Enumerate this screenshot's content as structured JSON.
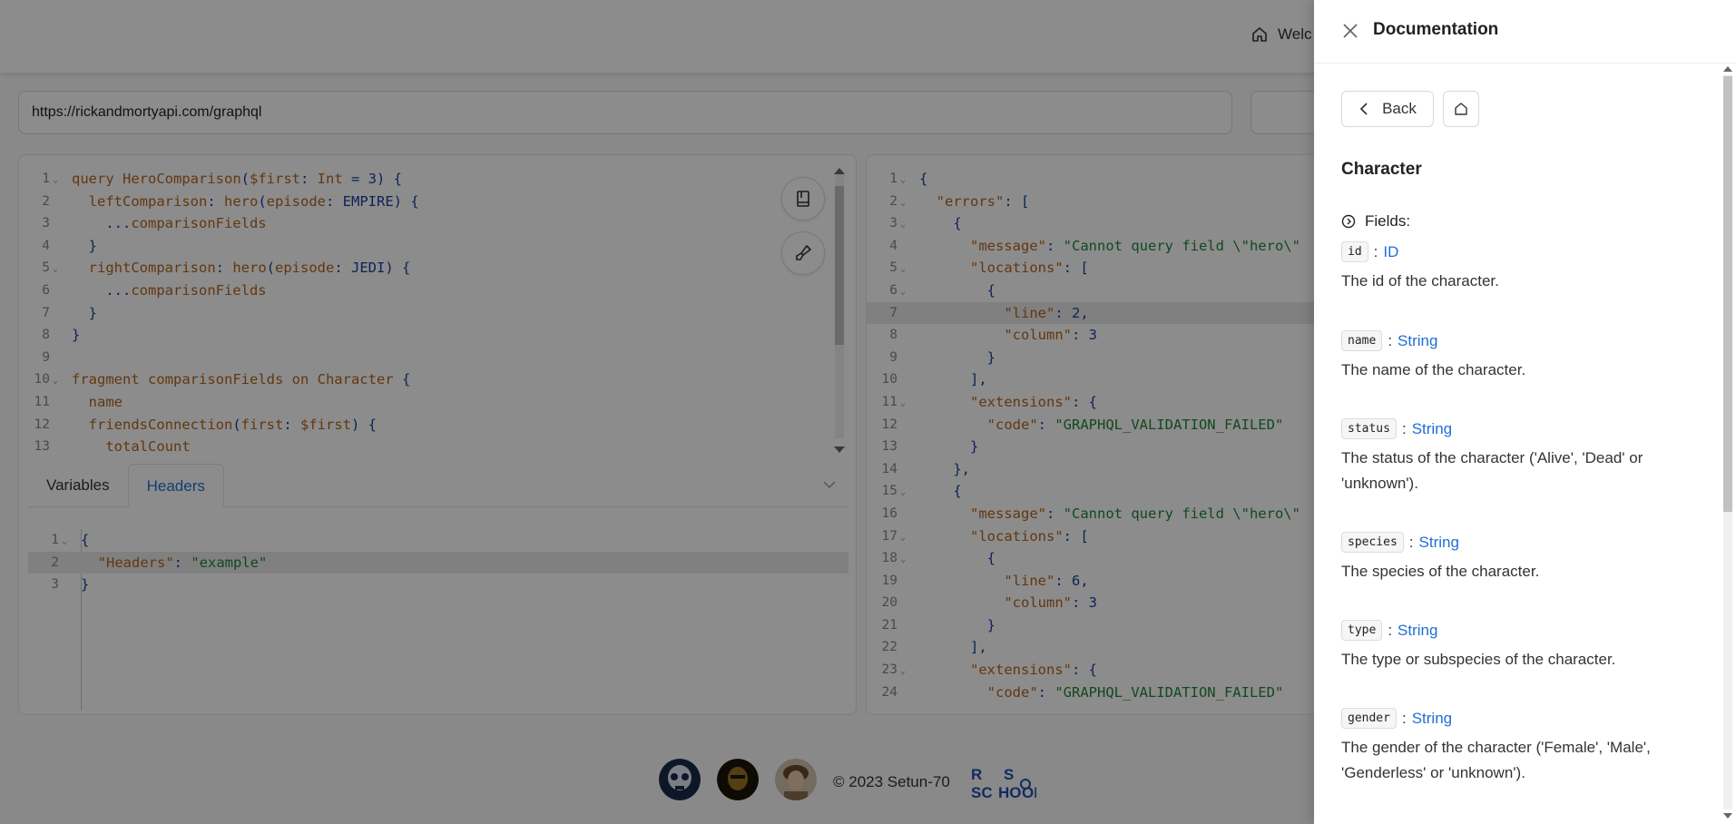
{
  "header": {
    "welcome_label": "Welc"
  },
  "url_bar": {
    "value": "https://rickandmortyapi.com/graphql"
  },
  "query_editor": {
    "lines": [
      {
        "n": "1",
        "fold": true,
        "segs": [
          [
            "kw",
            "query "
          ],
          [
            "fn",
            "HeroComparison"
          ],
          [
            "p",
            "("
          ],
          [
            "var",
            "$first"
          ],
          [
            "p",
            ": "
          ],
          [
            "type",
            "Int"
          ],
          [
            "p",
            " = "
          ],
          [
            "num",
            "3"
          ],
          [
            "p",
            ") {"
          ]
        ]
      },
      {
        "n": "2",
        "fold": false,
        "segs": [
          [
            "p",
            "  "
          ],
          [
            "fn",
            "leftComparison"
          ],
          [
            "p",
            ": "
          ],
          [
            "fn",
            "hero"
          ],
          [
            "p",
            "("
          ],
          [
            "arg",
            "episode"
          ],
          [
            "p",
            ": "
          ],
          [
            "enum",
            "EMPIRE"
          ],
          [
            "p",
            ") {"
          ]
        ]
      },
      {
        "n": "3",
        "fold": false,
        "segs": [
          [
            "p",
            "    ..."
          ],
          [
            "fn",
            "comparisonFields"
          ]
        ]
      },
      {
        "n": "4",
        "fold": false,
        "segs": [
          [
            "p",
            "  }"
          ]
        ]
      },
      {
        "n": "5",
        "fold": true,
        "segs": [
          [
            "p",
            "  "
          ],
          [
            "fn",
            "rightComparison"
          ],
          [
            "p",
            ": "
          ],
          [
            "fn",
            "hero"
          ],
          [
            "p",
            "("
          ],
          [
            "arg",
            "episode"
          ],
          [
            "p",
            ": "
          ],
          [
            "enum",
            "JEDI"
          ],
          [
            "p",
            ") {"
          ]
        ]
      },
      {
        "n": "6",
        "fold": false,
        "segs": [
          [
            "p",
            "    ..."
          ],
          [
            "fn",
            "comparisonFields"
          ]
        ]
      },
      {
        "n": "7",
        "fold": false,
        "segs": [
          [
            "p",
            "  }"
          ]
        ]
      },
      {
        "n": "8",
        "fold": false,
        "segs": [
          [
            "p",
            "}"
          ]
        ]
      },
      {
        "n": "9",
        "fold": false,
        "segs": []
      },
      {
        "n": "10",
        "fold": true,
        "segs": [
          [
            "kw",
            "fragment "
          ],
          [
            "fn",
            "comparisonFields"
          ],
          [
            "kw",
            " on "
          ],
          [
            "fn",
            "Character"
          ],
          [
            "p",
            " {"
          ]
        ]
      },
      {
        "n": "11",
        "fold": false,
        "segs": [
          [
            "p",
            "  "
          ],
          [
            "fn",
            "name"
          ]
        ]
      },
      {
        "n": "12",
        "fold": false,
        "segs": [
          [
            "p",
            "  "
          ],
          [
            "fn",
            "friendsConnection"
          ],
          [
            "p",
            "("
          ],
          [
            "arg",
            "first"
          ],
          [
            "p",
            ": "
          ],
          [
            "var",
            "$first"
          ],
          [
            "p",
            ") {"
          ]
        ]
      },
      {
        "n": "13",
        "fold": false,
        "segs": [
          [
            "p",
            "    "
          ],
          [
            "fn",
            "totalCount"
          ]
        ]
      }
    ]
  },
  "tabs": {
    "variables": "Variables",
    "headers": "Headers"
  },
  "headers_editor": {
    "lines": [
      {
        "n": "1",
        "fold": true,
        "hl": false,
        "segs": [
          [
            "p",
            "{"
          ]
        ]
      },
      {
        "n": "2",
        "fold": false,
        "hl": true,
        "segs": [
          [
            "p",
            "  "
          ],
          [
            "key",
            "\"Headers\""
          ],
          [
            "p",
            ": "
          ],
          [
            "str",
            "\"example\""
          ]
        ]
      },
      {
        "n": "3",
        "fold": false,
        "hl": false,
        "segs": [
          [
            "p",
            "}"
          ]
        ]
      }
    ]
  },
  "result_viewer": {
    "lines": [
      {
        "n": "1",
        "fold": true,
        "hl": false,
        "segs": [
          [
            "p",
            "{"
          ]
        ]
      },
      {
        "n": "2",
        "fold": true,
        "hl": false,
        "segs": [
          [
            "p",
            "  "
          ],
          [
            "key",
            "\"errors\""
          ],
          [
            "p",
            ": ["
          ]
        ]
      },
      {
        "n": "3",
        "fold": true,
        "hl": false,
        "segs": [
          [
            "p",
            "    {"
          ]
        ]
      },
      {
        "n": "4",
        "fold": false,
        "hl": false,
        "segs": [
          [
            "p",
            "      "
          ],
          [
            "key",
            "\"message\""
          ],
          [
            "p",
            ": "
          ],
          [
            "str",
            "\"Cannot query field \\\"hero\\\""
          ]
        ]
      },
      {
        "n": "5",
        "fold": true,
        "hl": false,
        "segs": [
          [
            "p",
            "      "
          ],
          [
            "key",
            "\"locations\""
          ],
          [
            "p",
            ": ["
          ]
        ]
      },
      {
        "n": "6",
        "fold": true,
        "hl": false,
        "segs": [
          [
            "p",
            "        {"
          ]
        ]
      },
      {
        "n": "7",
        "fold": false,
        "hl": true,
        "segs": [
          [
            "p",
            "          "
          ],
          [
            "key",
            "\"line\""
          ],
          [
            "p",
            ": "
          ],
          [
            "num",
            "2"
          ],
          [
            "p",
            ","
          ]
        ]
      },
      {
        "n": "8",
        "fold": false,
        "hl": false,
        "segs": [
          [
            "p",
            "          "
          ],
          [
            "key",
            "\"column\""
          ],
          [
            "p",
            ": "
          ],
          [
            "num",
            "3"
          ]
        ]
      },
      {
        "n": "9",
        "fold": false,
        "hl": false,
        "segs": [
          [
            "p",
            "        }"
          ]
        ]
      },
      {
        "n": "10",
        "fold": false,
        "hl": false,
        "segs": [
          [
            "p",
            "      ],"
          ]
        ]
      },
      {
        "n": "11",
        "fold": true,
        "hl": false,
        "segs": [
          [
            "p",
            "      "
          ],
          [
            "key",
            "\"extensions\""
          ],
          [
            "p",
            ": {"
          ]
        ]
      },
      {
        "n": "12",
        "fold": false,
        "hl": false,
        "segs": [
          [
            "p",
            "        "
          ],
          [
            "key",
            "\"code\""
          ],
          [
            "p",
            ": "
          ],
          [
            "str",
            "\"GRAPHQL_VALIDATION_FAILED\""
          ]
        ]
      },
      {
        "n": "13",
        "fold": false,
        "hl": false,
        "segs": [
          [
            "p",
            "      }"
          ]
        ]
      },
      {
        "n": "14",
        "fold": false,
        "hl": false,
        "segs": [
          [
            "p",
            "    },"
          ]
        ]
      },
      {
        "n": "15",
        "fold": true,
        "hl": false,
        "segs": [
          [
            "p",
            "    {"
          ]
        ]
      },
      {
        "n": "16",
        "fold": false,
        "hl": false,
        "segs": [
          [
            "p",
            "      "
          ],
          [
            "key",
            "\"message\""
          ],
          [
            "p",
            ": "
          ],
          [
            "str",
            "\"Cannot query field \\\"hero\\\""
          ]
        ]
      },
      {
        "n": "17",
        "fold": true,
        "hl": false,
        "segs": [
          [
            "p",
            "      "
          ],
          [
            "key",
            "\"locations\""
          ],
          [
            "p",
            ": ["
          ]
        ]
      },
      {
        "n": "18",
        "fold": true,
        "hl": false,
        "segs": [
          [
            "p",
            "        {"
          ]
        ]
      },
      {
        "n": "19",
        "fold": false,
        "hl": false,
        "segs": [
          [
            "p",
            "          "
          ],
          [
            "key",
            "\"line\""
          ],
          [
            "p",
            ": "
          ],
          [
            "num",
            "6"
          ],
          [
            "p",
            ","
          ]
        ]
      },
      {
        "n": "20",
        "fold": false,
        "hl": false,
        "segs": [
          [
            "p",
            "          "
          ],
          [
            "key",
            "\"column\""
          ],
          [
            "p",
            ": "
          ],
          [
            "num",
            "3"
          ]
        ]
      },
      {
        "n": "21",
        "fold": false,
        "hl": false,
        "segs": [
          [
            "p",
            "        }"
          ]
        ]
      },
      {
        "n": "22",
        "fold": false,
        "hl": false,
        "segs": [
          [
            "p",
            "      ],"
          ]
        ]
      },
      {
        "n": "23",
        "fold": true,
        "hl": false,
        "segs": [
          [
            "p",
            "      "
          ],
          [
            "key",
            "\"extensions\""
          ],
          [
            "p",
            ": {"
          ]
        ]
      },
      {
        "n": "24",
        "fold": false,
        "hl": false,
        "segs": [
          [
            "p",
            "        "
          ],
          [
            "key",
            "\"code\""
          ],
          [
            "p",
            ": "
          ],
          [
            "str",
            "\"GRAPHQL_VALIDATION_FAILED\""
          ]
        ]
      }
    ]
  },
  "footer": {
    "copyright": "© 2023 Setun-70",
    "school_logo_text": "RS SCHOOL"
  },
  "docs": {
    "title": "Documentation",
    "back_label": "Back",
    "type_name": "Character",
    "fields_label": "Fields:",
    "fields": [
      {
        "name": "id",
        "type": "ID",
        "desc": "The id of the character."
      },
      {
        "name": "name",
        "type": "String",
        "desc": "The name of the character."
      },
      {
        "name": "status",
        "type": "String",
        "desc": "The status of the character ('Alive', 'Dead' or 'unknown')."
      },
      {
        "name": "species",
        "type": "String",
        "desc": "The species of the character."
      },
      {
        "name": "type",
        "type": "String",
        "desc": "The type or subspecies of the character."
      },
      {
        "name": "gender",
        "type": "String",
        "desc": "The gender of the character ('Female', 'Male', 'Genderless' or 'unknown')."
      }
    ]
  },
  "colors": {
    "kw": "#b5651d",
    "fn": "#b5651d",
    "p": "#1a3fa0",
    "var": "#b5651d",
    "type": "#b5651d",
    "num": "#1a3fa0",
    "arg": "#b5651d",
    "enum": "#1a3fa0",
    "key": "#b5651d",
    "str": "#22863a",
    "link": "#1f6fd6"
  }
}
